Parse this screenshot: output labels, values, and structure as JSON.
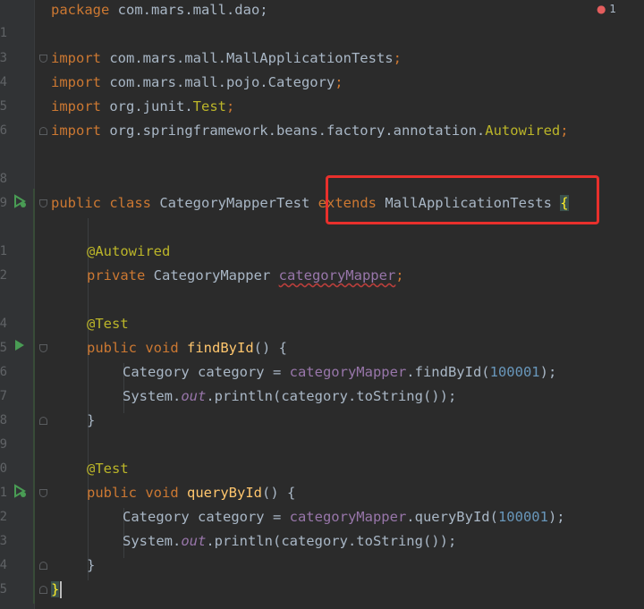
{
  "editor": {
    "warning_count": "1",
    "line_numbers": [
      "",
      "1",
      "3",
      "4",
      "5",
      "6",
      "",
      "8",
      "9",
      "",
      "1",
      "2",
      "",
      "4",
      "5",
      "6",
      "7",
      "8",
      "9",
      "0",
      "1",
      "2",
      "3",
      "4",
      "5"
    ]
  },
  "code": {
    "l1": {
      "kw": "package",
      "rest": " com.mars.mall.dao;"
    },
    "l3": {
      "kw": "import",
      "rest": " com.mars.mall.MallApplicationTests",
      "semi": ";"
    },
    "l4": {
      "kw": "import",
      "rest": " com.mars.mall.pojo.Category",
      "semi": ";"
    },
    "l5": {
      "kw": "import",
      "rest": " org.junit.",
      "ann": "Test",
      "semi": ";"
    },
    "l6": {
      "kw": "import",
      "rest": " org.springframework.beans.factory.annotation.",
      "ann": "Autowired",
      "semi": ";"
    },
    "l9": {
      "kw1": "public",
      "kw2": "class",
      "cls": " CategoryMapperTest ",
      "kw3": "extends",
      "sup": " MallApplicationTests ",
      "brace": "{"
    },
    "l11": {
      "ann": "@Autowired"
    },
    "l12": {
      "kw": "private",
      "type": " CategoryMapper ",
      "fld": "categoryMapper",
      "semi": ";"
    },
    "l14": {
      "ann": "@Test"
    },
    "l15": {
      "kw1": "public",
      "kw2": "void",
      "fn": "findById",
      "rest": "() {"
    },
    "l16": {
      "type": "Category category = ",
      "fld": "categoryMapper",
      "rest": ".findById(",
      "num": "100001",
      "end": ");"
    },
    "l17": {
      "a": "System.",
      "out": "out",
      "b": ".println(category.toString());"
    },
    "l18": {
      "text": "}"
    },
    "l20": {
      "ann": "@Test"
    },
    "l21": {
      "kw1": "public",
      "kw2": "void",
      "fn": "queryById",
      "rest": "() {"
    },
    "l22": {
      "type": "Category category = ",
      "fld": "categoryMapper",
      "rest": ".queryById(",
      "num": "100001",
      "end": ");"
    },
    "l23": {
      "a": "System.",
      "out": "out",
      "b": ".println(category.toString());"
    },
    "l24": {
      "text": "}"
    },
    "l25": {
      "text": "}"
    }
  },
  "colors": {
    "highlight_box": "#e8302c"
  }
}
